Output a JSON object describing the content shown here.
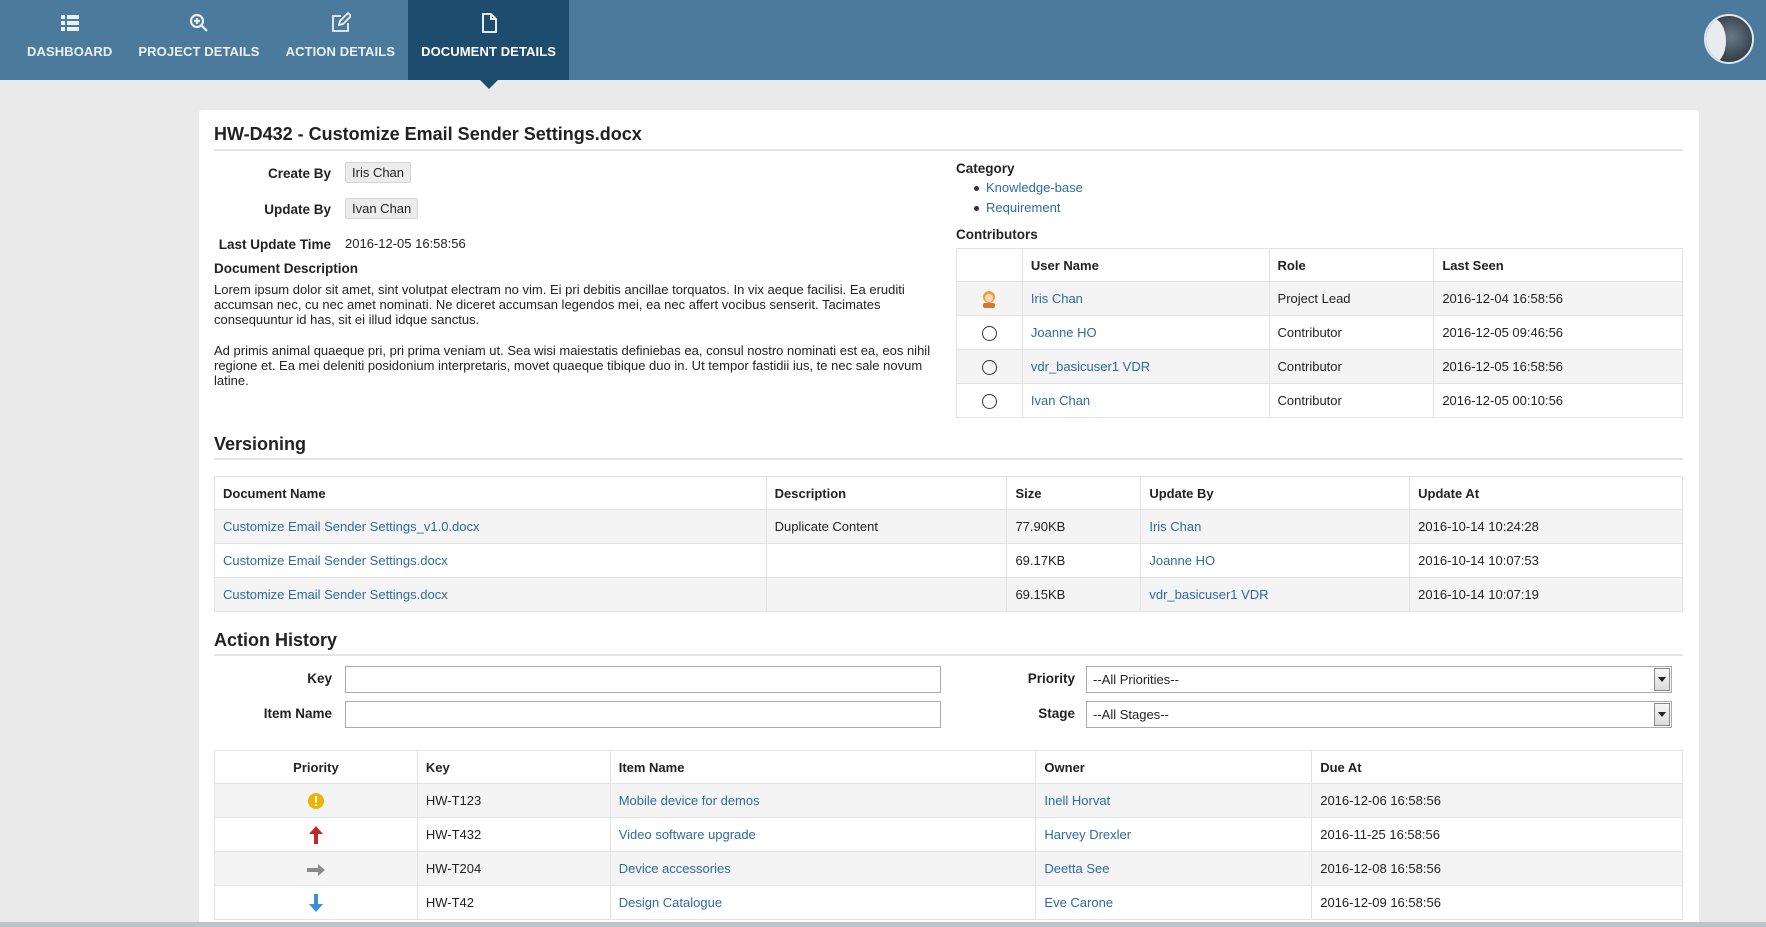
{
  "nav": {
    "items": [
      {
        "label": "DASHBOARD",
        "icon": "list-icon"
      },
      {
        "label": "PROJECT DETAILS",
        "icon": "zoom-in-icon"
      },
      {
        "label": "ACTION DETAILS",
        "icon": "edit-icon"
      },
      {
        "label": "DOCUMENT DETAILS",
        "icon": "file-icon"
      }
    ],
    "active": "DOCUMENT DETAILS"
  },
  "document": {
    "title": "HW-D432 - Customize Email Sender Settings.docx",
    "create_by_label": "Create By",
    "create_by": "Iris Chan",
    "update_by_label": "Update By",
    "update_by": "Ivan Chan",
    "last_update_label": "Last Update Time",
    "last_update": "2016-12-05 16:58:56",
    "description_label": "Document Description",
    "description_p1": "Lorem ipsum dolor sit amet, sint volutpat electram no vim. Ei pri debitis ancillae torquatos. In vix aeque facilisi. Ea eruditi accumsan nec, cu nec amet nominati. Ne diceret accumsan legendos mei, ea nec affert vocibus senserit. Tacimates consequuntur id has, sit ei illud idque sanctus.",
    "description_p2": "Ad primis animal quaeque pri, pri prima veniam ut. Sea wisi maiestatis definiebas ea, consul nostro nominati est ea, eos nihil regione et. Ea mei deleniti posidonium interpretaris, movet quaeque tibique duo in. Ut tempor fastidii ius, te nec sale novum latine."
  },
  "category": {
    "label": "Category",
    "items": [
      "Knowledge-base",
      "Requirement"
    ]
  },
  "contributors": {
    "label": "Contributors",
    "headers": [
      "User Name",
      "Role",
      "Last Seen"
    ],
    "rows": [
      {
        "name": "Iris Chan",
        "role": "Project Lead",
        "last_seen": "2016-12-04 16:58:56",
        "icon": "person-icon"
      },
      {
        "name": "Joanne HO",
        "role": "Contributor",
        "last_seen": "2016-12-05 09:46:56",
        "icon": "empty-avatar-icon"
      },
      {
        "name": "vdr_basicuser1 VDR",
        "role": "Contributor",
        "last_seen": "2016-12-05 16:58:56",
        "icon": "empty-avatar-icon"
      },
      {
        "name": "Ivan Chan",
        "role": "Contributor",
        "last_seen": "2016-12-05 00:10:56",
        "icon": "empty-avatar-icon"
      }
    ]
  },
  "versioning": {
    "title": "Versioning",
    "headers": [
      "Document Name",
      "Description",
      "Size",
      "Update By",
      "Update At"
    ],
    "rows": [
      {
        "name": "Customize Email Sender Settings_v1.0.docx",
        "description": "Duplicate Content",
        "size": "77.90KB",
        "update_by": "Iris Chan",
        "update_at": "2016-10-14 10:24:28"
      },
      {
        "name": "Customize Email Sender Settings.docx",
        "description": "",
        "size": "69.17KB",
        "update_by": "Joanne HO",
        "update_at": "2016-10-14 10:07:53"
      },
      {
        "name": "Customize Email Sender Settings.docx",
        "description": "",
        "size": "69.15KB",
        "update_by": "vdr_basicuser1 VDR",
        "update_at": "2016-10-14 10:07:19"
      }
    ]
  },
  "action_history": {
    "title": "Action History",
    "filters": {
      "key_label": "Key",
      "key_value": "",
      "item_name_label": "Item Name",
      "item_name_value": "",
      "priority_label": "Priority",
      "priority_value": "--All Priorities--",
      "stage_label": "Stage",
      "stage_value": "--All Stages--"
    },
    "headers": [
      "Priority",
      "Key",
      "Item Name",
      "Owner",
      "Due At"
    ],
    "rows": [
      {
        "priority_icon": "exclamation-circle-icon",
        "key": "HW-T123",
        "item": "Mobile device for demos",
        "owner": "Inell Horvat",
        "due": "2016-12-06 16:58:56"
      },
      {
        "priority_icon": "arrow-up-icon",
        "key": "HW-T432",
        "item": "Video software upgrade",
        "owner": "Harvey Drexler",
        "due": "2016-11-25 16:58:56"
      },
      {
        "priority_icon": "arrow-right-icon",
        "key": "HW-T204",
        "item": "Device accessories",
        "owner": "Deetta See",
        "due": "2016-12-08 16:58:56"
      },
      {
        "priority_icon": "arrow-down-icon",
        "key": "HW-T42",
        "item": "Design Catalogue",
        "owner": "Eve Carone",
        "due": "2016-12-09 16:58:56"
      }
    ]
  },
  "colors": {
    "nav_bg": "#4c7a9c",
    "nav_active": "#1e4c6e",
    "link": "#2e6aa3",
    "priority_high": "#c0282a",
    "priority_warn": "#f0b400",
    "priority_low": "#3a8fd6",
    "priority_normal": "#8a8a8a"
  }
}
